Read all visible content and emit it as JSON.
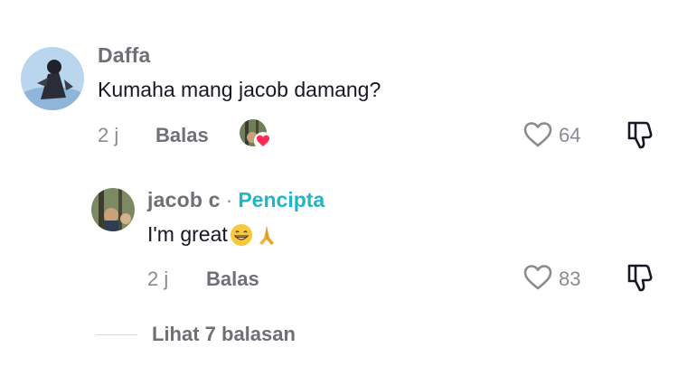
{
  "comments": [
    {
      "username": "Daffa",
      "text": "Kumaha mang jacob damang?",
      "time": "2 j",
      "reply_label": "Balas",
      "likes": "64",
      "liked_by_creator": true
    }
  ],
  "reply": {
    "username": "jacob c",
    "separator": "·",
    "badge": "Pencipta",
    "text": "I'm great",
    "emojis": [
      "grin-emoji",
      "folded-hands-emoji"
    ],
    "time": "2 j",
    "reply_label": "Balas",
    "likes": "83"
  },
  "view_replies_label": "Lihat 7 balasan",
  "colors": {
    "creator_badge": "#20b5c8",
    "heart_badge": "#fe2c55",
    "muted_text": "#8a8b91"
  }
}
